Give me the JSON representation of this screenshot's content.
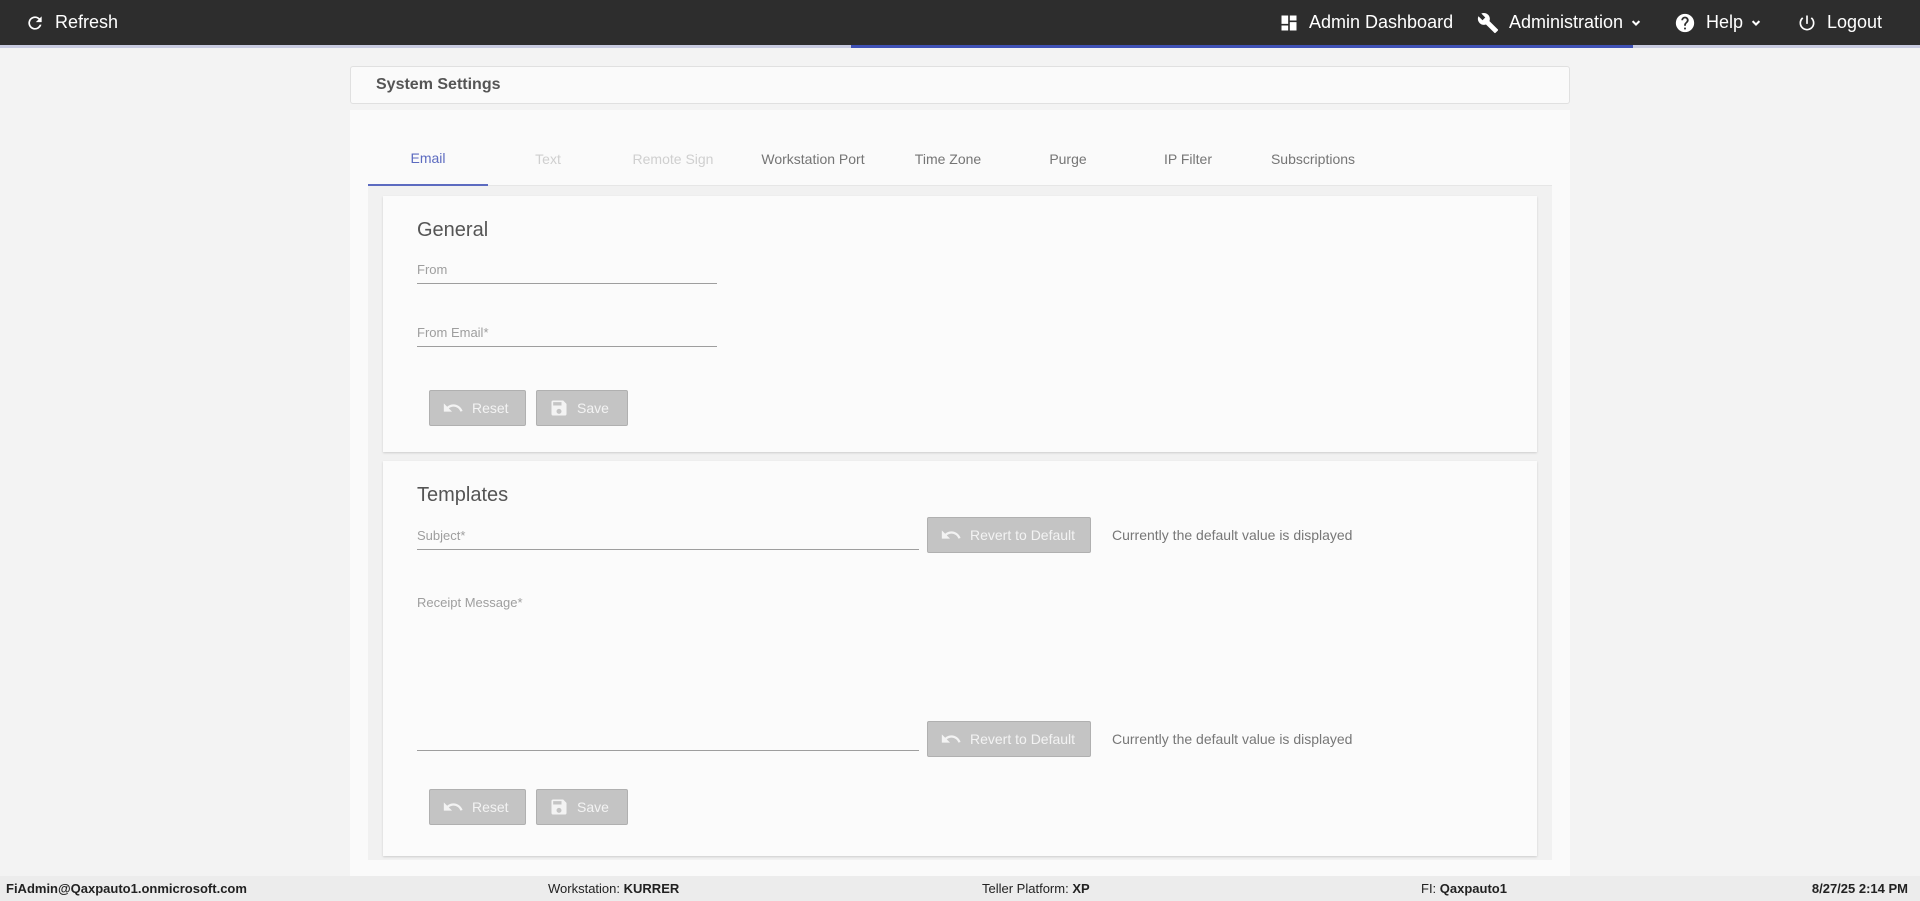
{
  "topbar": {
    "refresh": "Refresh",
    "admin_dashboard": "Admin Dashboard",
    "administration": "Administration",
    "help": "Help",
    "logout": "Logout"
  },
  "page": {
    "title": "System Settings"
  },
  "tabs": [
    {
      "label": "Email",
      "state": "active"
    },
    {
      "label": "Text",
      "state": "disabled"
    },
    {
      "label": "Remote Sign",
      "state": "disabled"
    },
    {
      "label": "Workstation Port",
      "state": "normal"
    },
    {
      "label": "Time Zone",
      "state": "normal"
    },
    {
      "label": "Purge",
      "state": "normal"
    },
    {
      "label": "IP Filter",
      "state": "normal"
    },
    {
      "label": "Subscriptions",
      "state": "normal"
    }
  ],
  "general": {
    "title": "General",
    "from_label": "From",
    "from_value": "",
    "from_email_label": "From Email*",
    "from_email_value": "",
    "reset": "Reset",
    "save": "Save"
  },
  "templates": {
    "title": "Templates",
    "subject_label": "Subject*",
    "subject_value": "",
    "revert": "Revert to Default",
    "default_hint": "Currently the default value is displayed",
    "receipt_label": "Receipt Message*",
    "receipt_value": "",
    "reset": "Reset",
    "save": "Save"
  },
  "footer": {
    "user": "FiAdmin@Qaxpauto1.onmicrosoft.com",
    "workstation_label": "Workstation:",
    "workstation_value": "KURRER",
    "platform_label": "Teller Platform:",
    "platform_value": "XP",
    "fi_label": "FI:",
    "fi_value": "Qaxpauto1",
    "datetime": "8/27/25 2:14 PM"
  },
  "icons": {
    "refresh": "refresh-icon",
    "dashboard": "dashboard-icon",
    "wrench": "wrench-icon",
    "help": "help-circle-icon",
    "power": "power-icon",
    "undo": "undo-icon",
    "save": "floppy-icon",
    "chevron": "chevron-down-icon"
  },
  "colors": {
    "accent": "#5c6bc0",
    "topbar": "#2d2d2d",
    "progress": "#3f51b5"
  }
}
